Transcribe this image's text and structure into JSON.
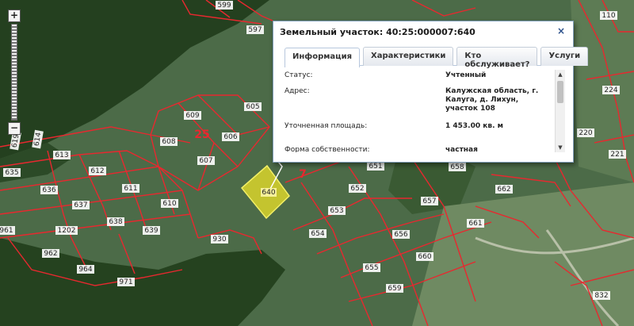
{
  "parcels": [
    {
      "id": "599",
      "label": "599"
    },
    {
      "id": "597",
      "label": "597"
    },
    {
      "id": "609",
      "label": "609"
    },
    {
      "id": "605",
      "label": "605"
    },
    {
      "id": "608",
      "label": "608"
    },
    {
      "id": "606",
      "label": "606"
    },
    {
      "id": "607",
      "label": "607"
    },
    {
      "id": "613",
      "label": "613"
    },
    {
      "id": "612",
      "label": "612"
    },
    {
      "id": "635",
      "label": "635"
    },
    {
      "id": "636",
      "label": "636"
    },
    {
      "id": "611",
      "label": "611"
    },
    {
      "id": "637",
      "label": "637"
    },
    {
      "id": "610",
      "label": "610"
    },
    {
      "id": "638",
      "label": "638"
    },
    {
      "id": "639",
      "label": "639"
    },
    {
      "id": "1202",
      "label": "1202"
    },
    {
      "id": "961",
      "label": "961"
    },
    {
      "id": "962",
      "label": "962"
    },
    {
      "id": "964",
      "label": "964"
    },
    {
      "id": "971",
      "label": "971"
    },
    {
      "id": "930",
      "label": "930"
    },
    {
      "id": "651",
      "label": "651"
    },
    {
      "id": "652",
      "label": "652"
    },
    {
      "id": "653",
      "label": "653"
    },
    {
      "id": "654",
      "label": "654"
    },
    {
      "id": "658",
      "label": "658"
    },
    {
      "id": "662",
      "label": "662"
    },
    {
      "id": "657",
      "label": "657"
    },
    {
      "id": "661",
      "label": "661"
    },
    {
      "id": "656",
      "label": "656"
    },
    {
      "id": "655",
      "label": "655"
    },
    {
      "id": "660",
      "label": "660"
    },
    {
      "id": "659",
      "label": "659"
    },
    {
      "id": "110",
      "label": "110"
    },
    {
      "id": "224",
      "label": "224"
    },
    {
      "id": "220",
      "label": "220"
    },
    {
      "id": "221",
      "label": "221"
    },
    {
      "id": "832",
      "label": "832"
    },
    {
      "id": "619",
      "label": "619"
    },
    {
      "id": "614",
      "label": "614"
    }
  ],
  "quarter_labels": [
    "25",
    "7"
  ],
  "selected_parcel": "640",
  "popup": {
    "title": "Земельный участок: 40:25:000007:640",
    "close_symbol": "×",
    "tabs": [
      "Информация",
      "Характеристики",
      "Кто обслуживает?",
      "Услуги"
    ],
    "rows": [
      {
        "label": "Статус:",
        "value": "Учтенный"
      },
      {
        "label": "Адрес:",
        "value": "Калужская область, г. Калуга, д. Лихун, участок 108"
      },
      {
        "label": "Уточненная площадь:",
        "value": "1 453.00 кв. м"
      },
      {
        "label": "Форма собственности:",
        "value": "частная"
      }
    ]
  },
  "zoom": {
    "plus": "+",
    "minus": "−"
  },
  "colors": {
    "boundary": "#e8282f",
    "selected_fill": "#d9d42c",
    "label_bg": "#ffffff"
  }
}
